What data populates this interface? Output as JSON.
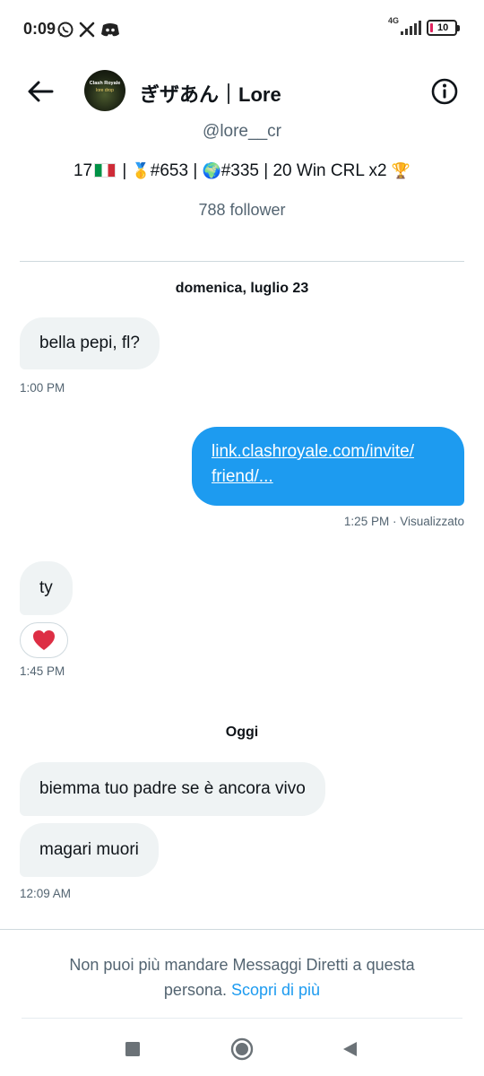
{
  "status_bar": {
    "time": "0:09",
    "network": "4G",
    "battery": "10",
    "battery_level": 0.1,
    "icons": [
      "whatsapp-icon",
      "x-icon",
      "discord-icon",
      "signal-icon",
      "battery-icon"
    ]
  },
  "header": {
    "name": "ぎザあん｜Lore",
    "avatar_line1": "Clash Royale",
    "avatar_line2": "lore drop",
    "back_icon": "arrow-left-icon",
    "info_icon": "info-icon"
  },
  "profile": {
    "handle": "@lore__cr",
    "bio_parts": {
      "age": "17",
      "rank1": "#653 |",
      "rank2": "#335 | 20 Win CRL x2"
    },
    "followers": "788 follower"
  },
  "conversation": {
    "sections": [
      {
        "date": "domenica, luglio 23",
        "messages": [
          {
            "direction": "in",
            "text": "bella pepi, fl?",
            "time": "1:00 PM"
          },
          {
            "direction": "out",
            "text": "link.clashroyale.com/invite/friend/...",
            "line1": "link.clashroyale.com/invite/",
            "line2": "friend/...",
            "time": "1:25 PM · Visualizzato"
          },
          {
            "direction": "in",
            "text": "ty",
            "reaction": "heart",
            "time": "1:45 PM"
          }
        ]
      },
      {
        "date": "Oggi",
        "messages": [
          {
            "direction": "in",
            "text": "biemma tuo padre se è ancora vivo"
          },
          {
            "direction": "in",
            "text": "magari muori",
            "time": "12:09 AM"
          }
        ]
      }
    ]
  },
  "footer": {
    "notice": "Non puoi più mandare Messaggi Diretti a questa persona.",
    "link": "Scopri di più"
  },
  "navbar": {
    "icons": [
      "recents-icon",
      "home-icon",
      "back-icon"
    ]
  },
  "colors": {
    "accent": "#1d9bf0",
    "text_primary": "#0f1419",
    "text_secondary": "#536471",
    "bubble_in": "#eff3f4",
    "divider": "#cfd9de",
    "heart": "#e0245e"
  }
}
